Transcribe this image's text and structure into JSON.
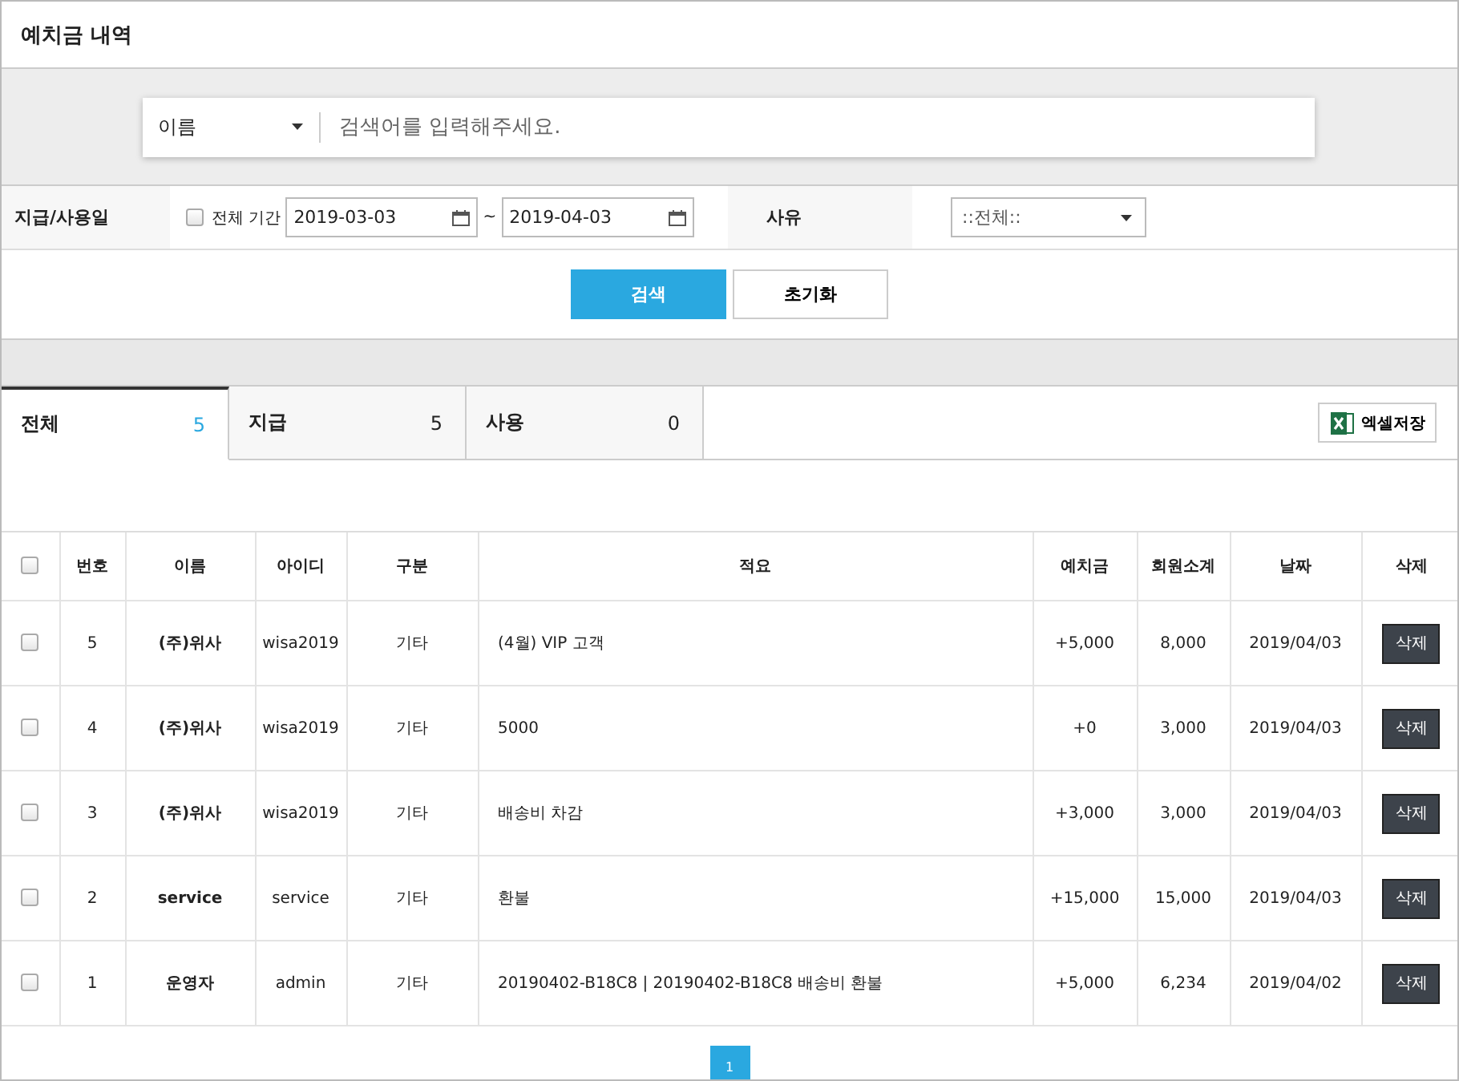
{
  "title": "예치금 내역",
  "search": {
    "field_select": "이름",
    "placeholder": "검색어를 입력해주세요."
  },
  "filter": {
    "date_label": "지급/사용일",
    "all_period": {
      "label": "전체 기간",
      "checked": false
    },
    "date_from": "2019-03-03",
    "separator": "~",
    "date_to": "2019-04-03",
    "reason_label": "사유",
    "reason_select": "::전체::"
  },
  "buttons": {
    "search": "검색",
    "reset": "초기화"
  },
  "tabs": [
    {
      "label": "전체",
      "count": "5",
      "selected": true
    },
    {
      "label": "지급",
      "count": "5",
      "selected": false
    },
    {
      "label": "사용",
      "count": "0",
      "selected": false
    }
  ],
  "excel_button": "엑셀저장",
  "table": {
    "select_all_checked": false,
    "columns": [
      "번호",
      "이름",
      "아이디",
      "구분",
      "적요",
      "예치금",
      "회원소계",
      "날짜",
      "삭제"
    ],
    "rows": [
      {
        "checked": false,
        "cells": [
          "5",
          "(주)위사",
          "wisa2019",
          "기타",
          "(4월) VIP 고객",
          "+5,000",
          "8,000",
          "2019/04/03"
        ],
        "delete_button": "삭제"
      },
      {
        "checked": false,
        "cells": [
          "4",
          "(주)위사",
          "wisa2019",
          "기타",
          "5000",
          "+0",
          "3,000",
          "2019/04/03"
        ],
        "delete_button": "삭제"
      },
      {
        "checked": false,
        "cells": [
          "3",
          "(주)위사",
          "wisa2019",
          "기타",
          "배송비 차감",
          "+3,000",
          "3,000",
          "2019/04/03"
        ],
        "delete_button": "삭제"
      },
      {
        "checked": false,
        "cells": [
          "2",
          "service",
          "service",
          "기타",
          "환불",
          "+15,000",
          "15,000",
          "2019/04/03"
        ],
        "delete_button": "삭제"
      },
      {
        "checked": false,
        "cells": [
          "1",
          "운영자",
          "admin",
          "기타",
          "20190402-B18C8 | 20190402-B18C8 배송비 환불",
          "+5,000",
          "6,234",
          "2019/04/02"
        ],
        "delete_button": "삭제"
      }
    ]
  },
  "pagination": [
    {
      "label": "1",
      "selected": true
    }
  ]
}
